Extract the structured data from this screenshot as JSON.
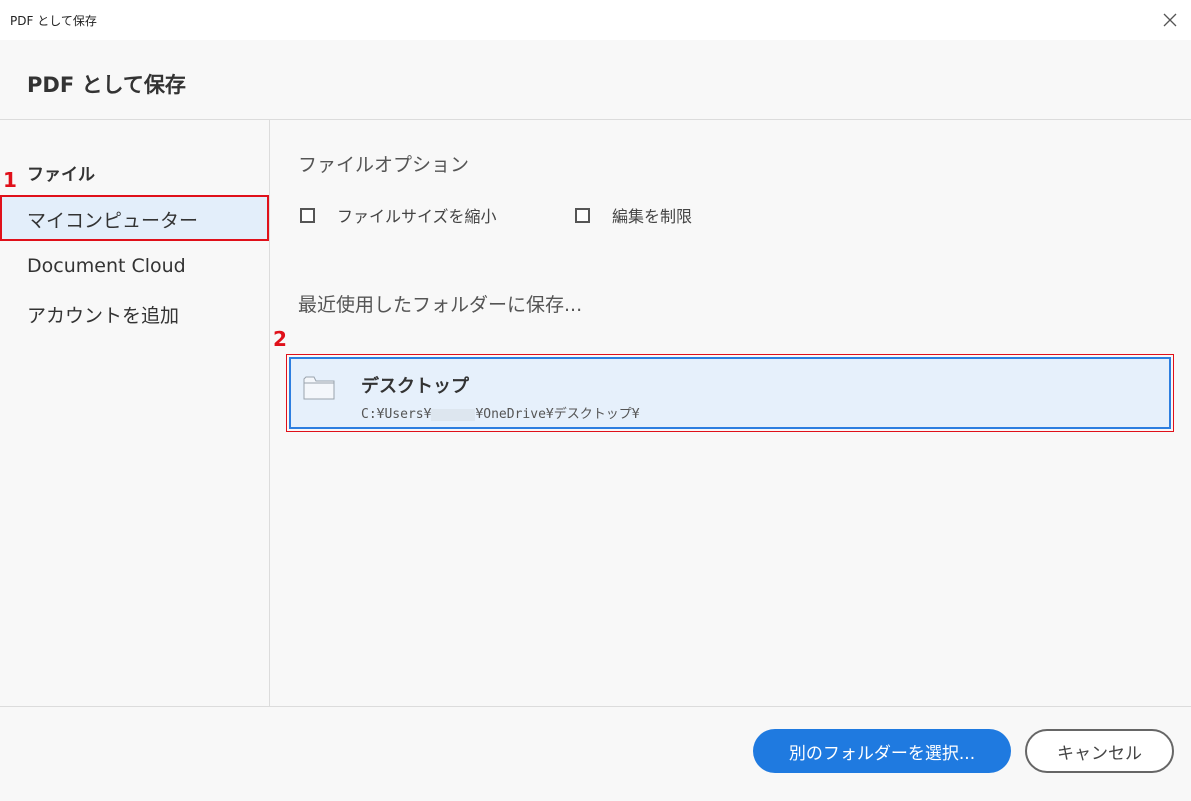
{
  "window": {
    "title": "PDF として保存"
  },
  "header": {
    "title": "PDF として保存"
  },
  "sidebar": {
    "section": "ファイル",
    "items": [
      {
        "label": "マイコンピューター",
        "selected": true
      },
      {
        "label": "Document Cloud",
        "selected": false
      },
      {
        "label": "アカウントを追加",
        "selected": false
      }
    ]
  },
  "main": {
    "options_heading": "ファイルオプション",
    "options": [
      {
        "label": "ファイルサイズを縮小",
        "checked": false
      },
      {
        "label": "編集を制限",
        "checked": false
      }
    ],
    "recent_heading": "最近使用したフォルダーに保存...",
    "recent_folders": [
      {
        "name": "デスクトップ",
        "path_prefix": "C:¥Users¥",
        "path_suffix": "¥OneDrive¥デスクトップ¥",
        "icon": "folder-icon"
      }
    ]
  },
  "annotations": {
    "marker_1": "1",
    "marker_2": "2",
    "color": "#e0101a"
  },
  "footer": {
    "choose_folder_label": "別のフォルダーを選択...",
    "cancel_label": "キャンセル"
  },
  "colors": {
    "accent": "#1f7ae0",
    "selection_bg": "#e3eefa",
    "panel_bg": "#f8f8f8"
  }
}
